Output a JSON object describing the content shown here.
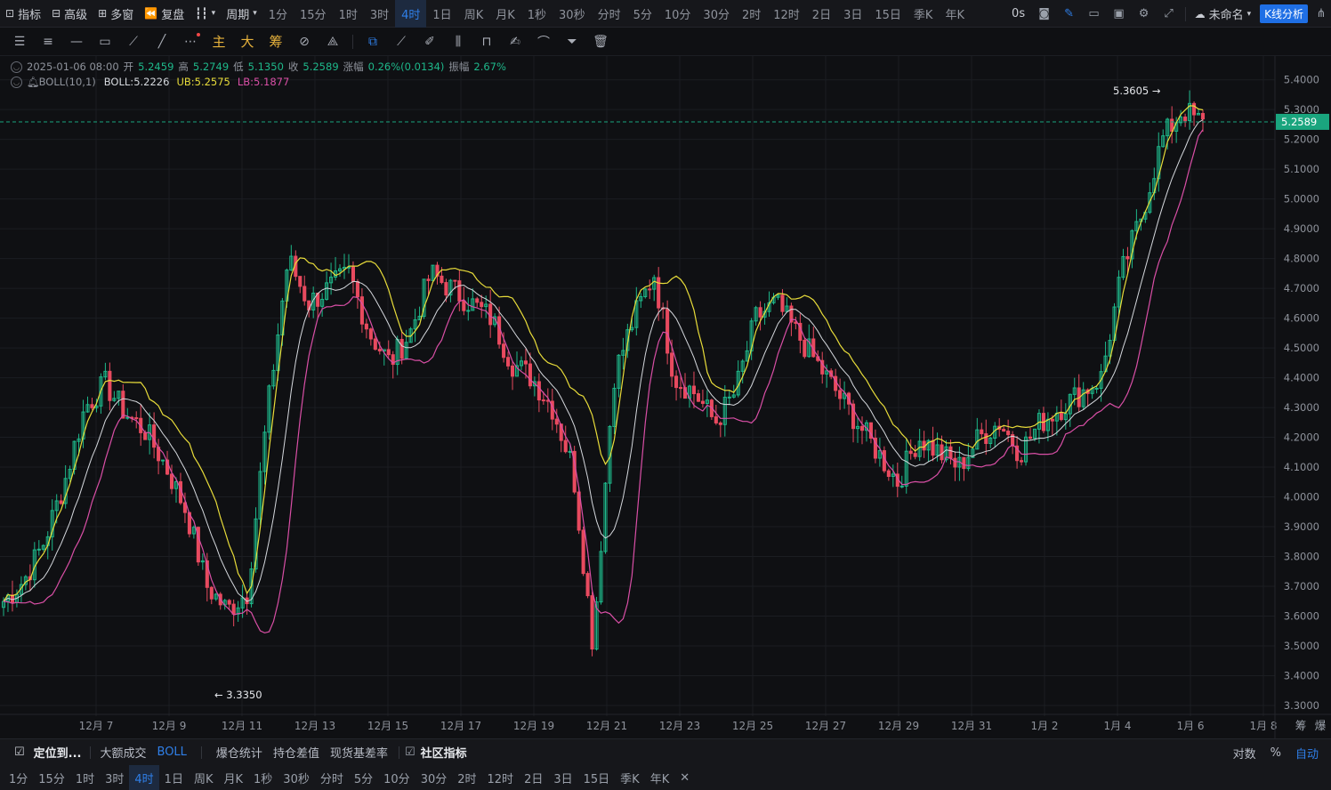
{
  "toolbar": {
    "indicator": "指标",
    "advanced": "高级",
    "multi_window": "多窗",
    "replay": "复盘",
    "period_label": "周期",
    "periods": [
      "1分",
      "15分",
      "1时",
      "3时",
      "4时",
      "1日",
      "周K",
      "月K",
      "1秒",
      "30秒",
      "分时",
      "5分",
      "10分",
      "30分",
      "2时",
      "12时",
      "2日",
      "3日",
      "15日",
      "季K",
      "年K"
    ],
    "active_period": "4时",
    "countdown": "0s",
    "layout_name": "未命名",
    "kline_analysis": "K线分析"
  },
  "drawing": {
    "main": "主",
    "big": "大",
    "chips": "筹"
  },
  "ohlc": {
    "datetime": "2025-01-06 08:00",
    "open_label": "开",
    "open": "5.2459",
    "high_label": "高",
    "high": "5.2749",
    "low_label": "低",
    "low": "5.1350",
    "close_label": "收",
    "close": "5.2589",
    "change_label": "涨幅",
    "change": "0.26%(0.0134)",
    "amp_label": "振幅",
    "amp": "2.67%"
  },
  "boll": {
    "label": "BOLL(10,1)",
    "mid_label": "BOLL:",
    "mid": "5.2226",
    "ub_label": "UB:",
    "ub": "5.2575",
    "lb_label": "LB:",
    "lb": "5.1877"
  },
  "colors": {
    "up": "#1eb88a",
    "down": "#e84a5f",
    "ub": "#e8dc3a",
    "mid": "#d5d8dd",
    "lb": "#d94fa6",
    "accent": "#2f7fe8",
    "price_tag": "#1aa57e"
  },
  "chart_data": {
    "type": "candlestick",
    "y_ticks": [
      "5.4000",
      "5.3000",
      "5.2000",
      "5.1000",
      "5.0000",
      "4.9000",
      "4.8000",
      "4.7000",
      "4.6000",
      "4.5000",
      "4.4000",
      "4.3000",
      "4.2000",
      "4.1000",
      "4.0000",
      "3.9000",
      "3.8000",
      "3.7000",
      "3.6000",
      "3.5000",
      "3.4000",
      "3.3000"
    ],
    "ylim": [
      3.27,
      5.42
    ],
    "x_ticks": [
      "12月 7",
      "12月 9",
      "12月 11",
      "12月 13",
      "12月 15",
      "12月 17",
      "12月 19",
      "12月 21",
      "12月 23",
      "12月 25",
      "12月 27",
      "12月 29",
      "12月 31",
      "1月 2",
      "1月 4",
      "1月 6",
      "1月 8"
    ],
    "last_price": "5.2589",
    "high_marker": "5.3605 →",
    "low_marker": "← 3.3350",
    "key_closes": [
      3.65,
      3.72,
      3.85,
      4.05,
      4.3,
      4.38,
      4.28,
      4.22,
      4.1,
      3.95,
      3.7,
      3.62,
      3.68,
      4.3,
      4.8,
      4.65,
      4.7,
      4.75,
      4.55,
      4.45,
      4.55,
      4.75,
      4.7,
      4.65,
      4.6,
      4.45,
      4.4,
      4.3,
      4.1,
      3.5,
      4.4,
      4.6,
      4.75,
      4.4,
      4.35,
      4.25,
      4.35,
      4.6,
      4.65,
      4.55,
      4.45,
      4.35,
      4.25,
      4.15,
      4.05,
      4.2,
      4.15,
      4.1,
      4.2,
      4.25,
      4.15,
      4.25,
      4.3,
      4.35,
      4.4,
      4.75,
      4.95,
      5.2,
      5.3,
      5.25
    ]
  },
  "bottom": {
    "locate": "定位到...",
    "big_trades": "大额成交",
    "boll": "BOLL",
    "liq_stats": "爆仓统计",
    "oi_diff": "持仓差值",
    "basis": "现货基差率",
    "community": "社区指标",
    "log": "对数",
    "percent": "%",
    "auto": "自动",
    "chips": "筹",
    "burst": "爆"
  },
  "period_bar": [
    "1分",
    "15分",
    "1时",
    "3时",
    "4时",
    "1日",
    "周K",
    "月K",
    "1秒",
    "30秒",
    "分时",
    "5分",
    "10分",
    "30分",
    "2时",
    "12时",
    "2日",
    "3日",
    "15日",
    "季K",
    "年K"
  ],
  "period_bar_active": "4时"
}
